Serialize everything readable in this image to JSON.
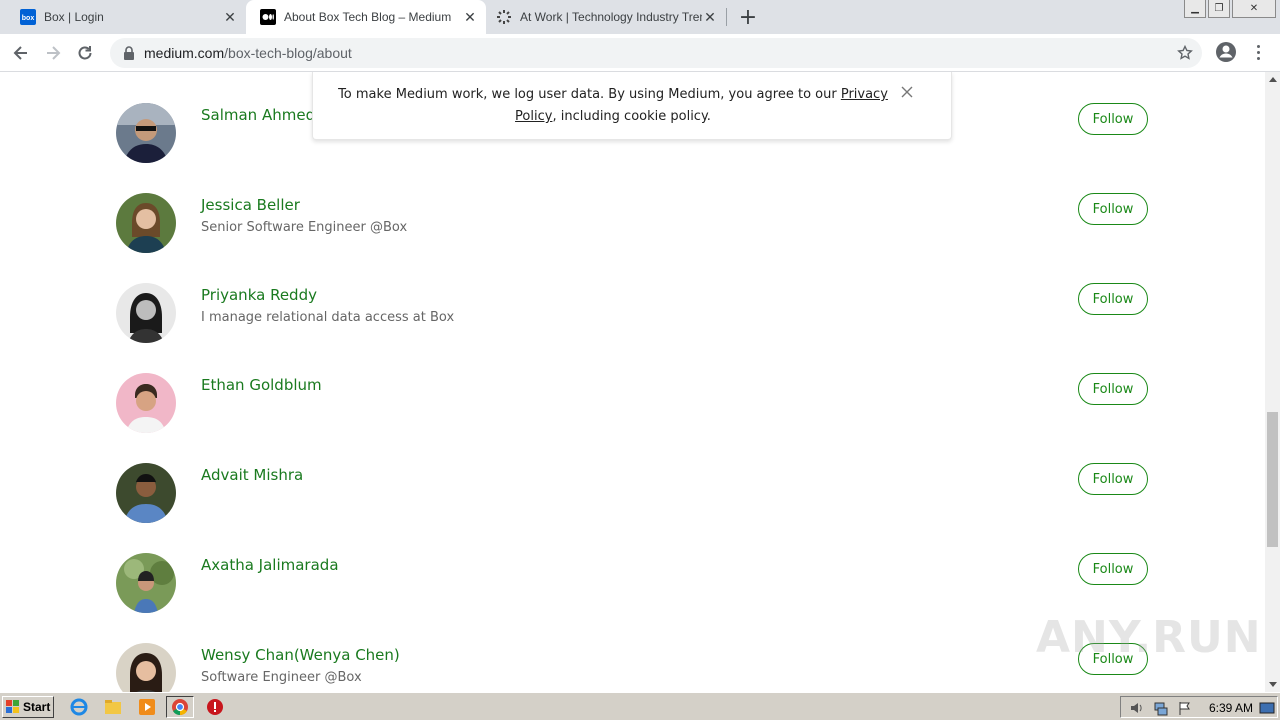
{
  "browser": {
    "tabs": [
      {
        "title": "Box | Login",
        "icon": "box-favicon",
        "active": false
      },
      {
        "title": "About Box Tech Blog – Medium",
        "icon": "medium-favicon",
        "active": true
      },
      {
        "title": "At Work | Technology Industry Tren",
        "icon": "loading-spinner-icon",
        "active": false
      }
    ],
    "url_host": "medium.com",
    "url_path": "/box-tech-blog/about"
  },
  "cookie_banner": {
    "text_before": "To make Medium work, we log user data. By using Medium, you agree to our ",
    "link_text": "Privacy Policy",
    "text_after": ", including cookie policy."
  },
  "members": [
    {
      "name": "Salman Ahmed",
      "bio": "",
      "follow_label": "Follow"
    },
    {
      "name": "Jessica Beller",
      "bio": "Senior Software Engineer @Box",
      "follow_label": "Follow"
    },
    {
      "name": "Priyanka Reddy",
      "bio": "I manage relational data access at Box",
      "follow_label": "Follow"
    },
    {
      "name": "Ethan Goldblum",
      "bio": "",
      "follow_label": "Follow"
    },
    {
      "name": "Advait Mishra",
      "bio": "",
      "follow_label": "Follow"
    },
    {
      "name": "Axatha Jalimarada",
      "bio": "",
      "follow_label": "Follow"
    },
    {
      "name": "Wensy Chan(Wenya Chen)",
      "bio": "Software Engineer @Box",
      "follow_label": "Follow"
    }
  ],
  "watermark": "ANY.RUN",
  "taskbar": {
    "start_label": "Start",
    "clock": "6:39 AM"
  },
  "colors": {
    "accent_green": "#1a8917",
    "tab_strip": "#dee1e6",
    "taskbar": "#d4d0c8"
  }
}
